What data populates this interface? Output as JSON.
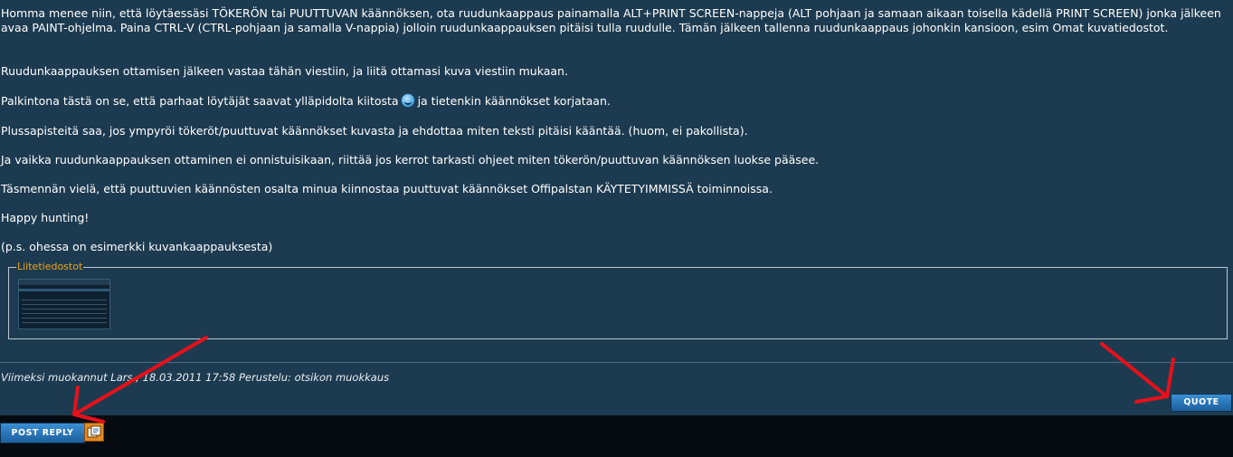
{
  "post": {
    "paragraphs": [
      "Homma menee niin, että löytäessäsi TÖKERÖN tai PUUTTUVAN käännöksen, ota ruudunkaappaus painamalla ALT+PRINT SCREEN-nappeja (ALT pohjaan ja samaan aikaan toisella kädellä PRINT SCREEN) jonka jälkeen avaa PAINT-ohjelma. Paina CTRL-V (CTRL-pohjaan ja samalla V-nappia) jolloin ruudunkaappauksen pitäisi tulla ruudulle. Tämän jälkeen tallenna ruudunkaappaus johonkin kansioon, esim Omat kuvatiedostot.",
      "Ruudunkaappauksen ottamisen jälkeen vastaa tähän viestiin, ja liitä ottamasi kuva viestiin mukaan.",
      "Palkintona tästä on se, että parhaat löytäjät saavat ylläpidolta kiitosta",
      "ja tietenkin käännökset korjataan.",
      "Plussapisteitä saa, jos ympyröi tökeröt/puuttuvat käännökset kuvasta ja ehdottaa miten teksti pitäisi kääntää. (huom, ei pakollista).",
      "Ja vaikka ruudunkaappauksen ottaminen ei onnistuisikaan, riittää jos kerrot tarkasti ohjeet miten tökerön/puuttuvan käännöksen luokse pääsee.",
      "Täsmennän vielä, että puuttuvien käännösten osalta minua kiinnostaa puuttuvat käännökset Offipalstan KÄYTETYIMMISSÄ toiminnoissa.",
      "Happy hunting!",
      "(p.s. ohessa on esimerkki kuvankaappauksesta)"
    ],
    "smiley_icon": "smiley-icon",
    "attachments": {
      "legend": "Liitetiedostot"
    },
    "edit_note": "Viimeksi muokannut Lars ; 18.03.2011 17:58 Perustelu: otsikon muokkaus"
  },
  "buttons": {
    "quote": "QUOTE",
    "post_reply": "POST REPLY"
  },
  "annotations": {
    "color": "#e8101a",
    "shape": "red hand-drawn arrows pointing to POST REPLY and QUOTE buttons"
  },
  "colors": {
    "background": "#1d3b50",
    "text": "#ffffff",
    "legend": "#f0a21a",
    "button": "#2a78bd",
    "bottom_strip": "#050b10"
  }
}
